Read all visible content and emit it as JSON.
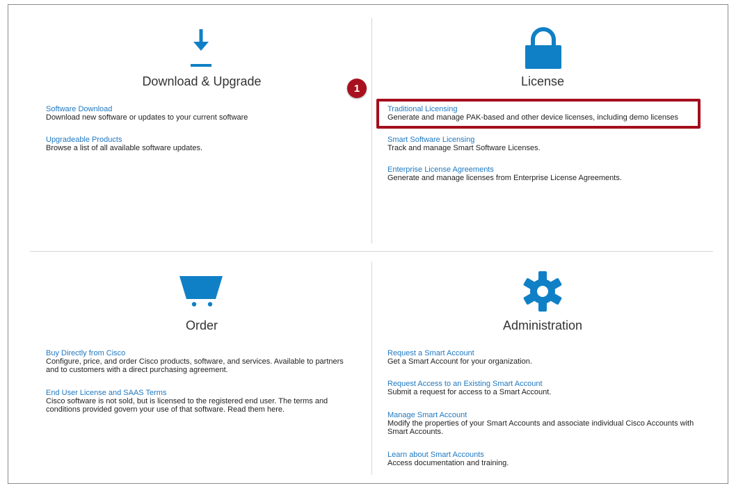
{
  "colors": {
    "link": "#1f78c1",
    "icon": "#1080c6",
    "highlight": "#a50e1d",
    "badge": "#a8111f"
  },
  "callout": {
    "number": "1"
  },
  "sections": {
    "download": {
      "title": "Download & Upgrade",
      "icon": "download-icon",
      "items": [
        {
          "link": "Software Download",
          "desc": "Download new software or updates to your current software"
        },
        {
          "link": "Upgradeable Products",
          "desc": "Browse a list of all available software updates."
        }
      ]
    },
    "license": {
      "title": "License",
      "icon": "lock-icon",
      "items": [
        {
          "link": "Traditional Licensing",
          "desc": "Generate and manage PAK-based and other device licenses, including demo licenses"
        },
        {
          "link": "Smart Software Licensing",
          "desc": "Track and manage Smart Software Licenses."
        },
        {
          "link": "Enterprise License Agreements",
          "desc": "Generate and manage licenses from Enterprise License Agreements."
        }
      ]
    },
    "order": {
      "title": "Order",
      "icon": "cart-icon",
      "items": [
        {
          "link": "Buy Directly from Cisco",
          "desc": "Configure, price, and order Cisco products, software, and services. Available to partners and to customers with a direct purchasing agreement."
        },
        {
          "link": "End User License and SAAS Terms",
          "desc": "Cisco software is not sold, but is licensed to the registered end user. The terms and conditions provided govern your use of that software. Read them here."
        }
      ]
    },
    "admin": {
      "title": "Administration",
      "icon": "gear-icon",
      "items": [
        {
          "link": "Request a Smart Account",
          "desc": "Get a Smart Account for your organization."
        },
        {
          "link": "Request Access to an Existing Smart Account",
          "desc": "Submit a request for access to a Smart Account."
        },
        {
          "link": "Manage Smart Account",
          "desc": "Modify the properties of your Smart Accounts and associate individual Cisco Accounts with Smart Accounts."
        },
        {
          "link": "Learn about Smart Accounts",
          "desc": "Access documentation and training."
        }
      ]
    }
  }
}
